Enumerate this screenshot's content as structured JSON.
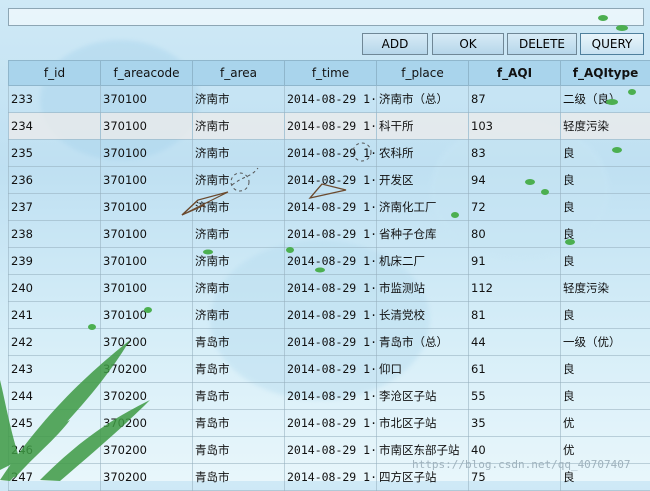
{
  "toolbar": {
    "add_label": "ADD",
    "ok_label": "OK",
    "delete_label": "DELETE",
    "query_label": "QUERY"
  },
  "table": {
    "columns": [
      "f_id",
      "f_areacode",
      "f_area",
      "f_time",
      "f_place",
      "f_AQI",
      "f_AQItype"
    ],
    "rows": [
      [
        "233",
        "370100",
        "济南市",
        "2014-08-29 1···",
        "济南市（总）",
        "87",
        "二级（良）"
      ],
      [
        "234",
        "370100",
        "济南市",
        "2014-08-29 1···",
        "科干所",
        "103",
        "轻度污染"
      ],
      [
        "235",
        "370100",
        "济南市",
        "2014-08-29 1···",
        "农科所",
        "83",
        "良"
      ],
      [
        "236",
        "370100",
        "济南市",
        "2014-08-29 1···",
        "开发区",
        "94",
        "良"
      ],
      [
        "237",
        "370100",
        "济南市",
        "2014-08-29 1···",
        "济南化工厂",
        "72",
        "良"
      ],
      [
        "238",
        "370100",
        "济南市",
        "2014-08-29 1···",
        "省种子仓库",
        "80",
        "良"
      ],
      [
        "239",
        "370100",
        "济南市",
        "2014-08-29 1···",
        "机床二厂",
        "91",
        "良"
      ],
      [
        "240",
        "370100",
        "济南市",
        "2014-08-29 1···",
        "市监测站",
        "112",
        "轻度污染"
      ],
      [
        "241",
        "370100",
        "济南市",
        "2014-08-29 1···",
        "长清党校",
        "81",
        "良"
      ],
      [
        "242",
        "370200",
        "青岛市",
        "2014-08-29 1···",
        "青岛市（总）",
        "44",
        "一级（优）"
      ],
      [
        "243",
        "370200",
        "青岛市",
        "2014-08-29 1···",
        "仰口",
        "61",
        "良"
      ],
      [
        "244",
        "370200",
        "青岛市",
        "2014-08-29 1···",
        "李沧区子站",
        "55",
        "良"
      ],
      [
        "245",
        "370200",
        "青岛市",
        "2014-08-29 1···",
        "市北区子站",
        "35",
        "优"
      ],
      [
        "246",
        "370200",
        "青岛市",
        "2014-08-29 1···",
        "市南区东部子站",
        "40",
        "优"
      ],
      [
        "247",
        "370200",
        "青岛市",
        "2014-08-29 1···",
        "四方区子站",
        "75",
        "良"
      ]
    ]
  },
  "watermark": "https://blog.csdn.net/qq_40707407",
  "colors": {
    "header": "#a9d4ec",
    "button": "#c4e0f0",
    "leaf": "#4caf50"
  }
}
